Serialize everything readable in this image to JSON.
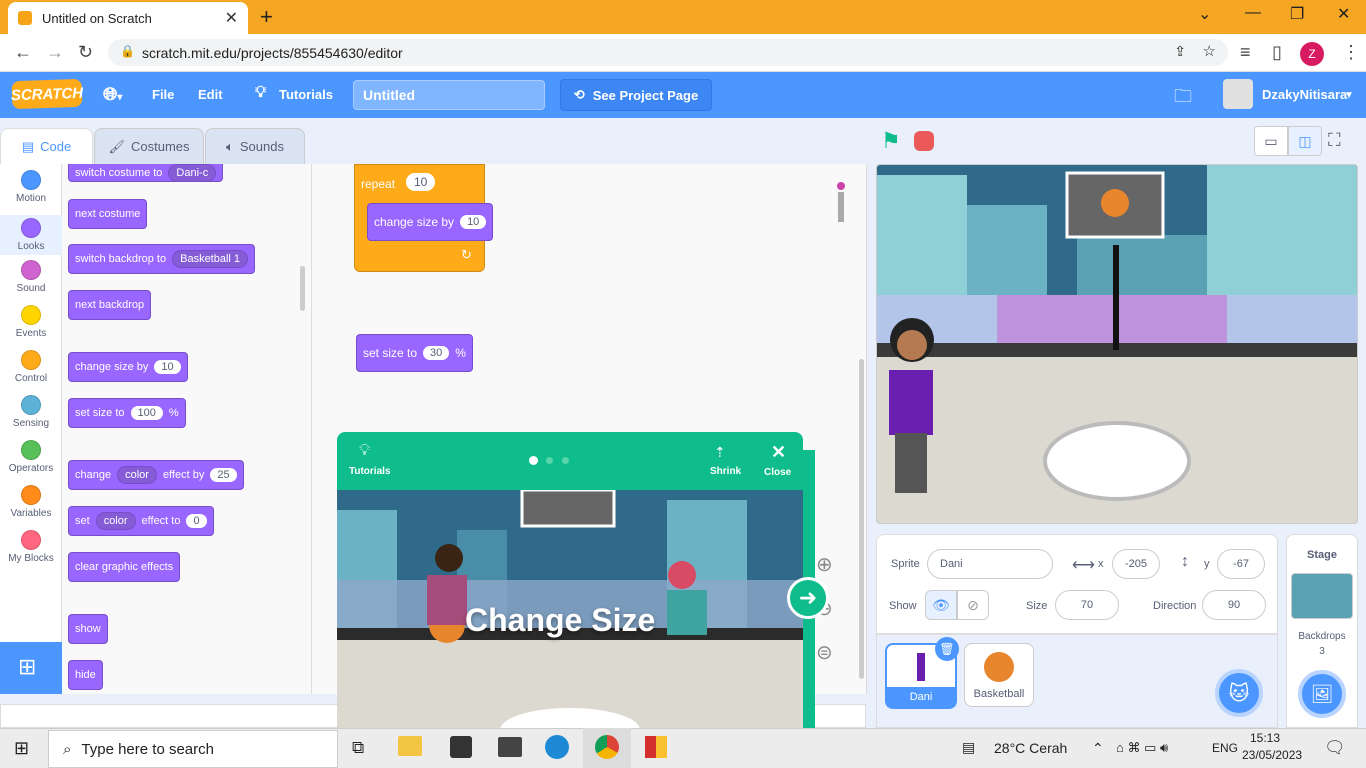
{
  "browser": {
    "tab_title": "Untitled on Scratch",
    "url": "scratch.mit.edu/projects/855454630/editor",
    "profile_initial": "Z"
  },
  "menu": {
    "logo": "SCRATCH",
    "file": "File",
    "edit": "Edit",
    "tutorials": "Tutorials",
    "project_title": "Untitled",
    "see_project_page": "See Project Page",
    "username": "DzakyNitisara"
  },
  "tabs": {
    "code": "Code",
    "costumes": "Costumes",
    "sounds": "Sounds"
  },
  "categories": [
    {
      "label": "Motion",
      "color": "#4c97ff"
    },
    {
      "label": "Looks",
      "color": "#9966ff"
    },
    {
      "label": "Sound",
      "color": "#cf63cf"
    },
    {
      "label": "Events",
      "color": "#ffd500"
    },
    {
      "label": "Control",
      "color": "#ffab19"
    },
    {
      "label": "Sensing",
      "color": "#5cb1d6"
    },
    {
      "label": "Operators",
      "color": "#59c059"
    },
    {
      "label": "Variables",
      "color": "#ff8c1a"
    },
    {
      "label": "My Blocks",
      "color": "#ff6680"
    }
  ],
  "palette": {
    "switch_costume": "switch costume to",
    "switch_costume_val": "Dani-c",
    "next_costume": "next costume",
    "switch_backdrop": "switch backdrop to",
    "switch_backdrop_val": "Basketball 1",
    "next_backdrop": "next backdrop",
    "change_size": "change size by",
    "change_size_val": "10",
    "set_size": "set size to",
    "set_size_val": "100",
    "percent": "%",
    "change_effect": "change",
    "effect_val": "color",
    "effect_by": "effect by",
    "effect_by_val": "25",
    "set_effect": "set",
    "effect_to": "effect to",
    "effect_to_val": "0",
    "clear_effects": "clear graphic effects",
    "show": "show",
    "hide": "hide"
  },
  "workspace": {
    "repeat": "repeat",
    "repeat_val": "10",
    "change_size": "change size by",
    "change_size_val": "10",
    "set_size": "set size to",
    "set_size_val": "30",
    "percent": "%"
  },
  "tutorial": {
    "tutorials_label": "Tutorials",
    "shrink": "Shrink",
    "close": "Close",
    "heading": "Change Size"
  },
  "sprite_info": {
    "sprite_label": "Sprite",
    "sprite_name": "Dani",
    "x_label": "x",
    "x_val": "-205",
    "y_label": "y",
    "y_val": "-67",
    "show_label": "Show",
    "size_label": "Size",
    "size_val": "70",
    "direction_label": "Direction",
    "direction_val": "90"
  },
  "sprites": [
    {
      "name": "Dani"
    },
    {
      "name": "Basketball"
    }
  ],
  "stage_panel": {
    "title": "Stage",
    "backdrops_label": "Backdrops",
    "backdrops_count": "3"
  },
  "taskbar": {
    "search_placeholder": "Type here to search",
    "weather": "28°C  Cerah",
    "lang": "ENG",
    "time": "15:13",
    "date": "23/05/2023"
  }
}
